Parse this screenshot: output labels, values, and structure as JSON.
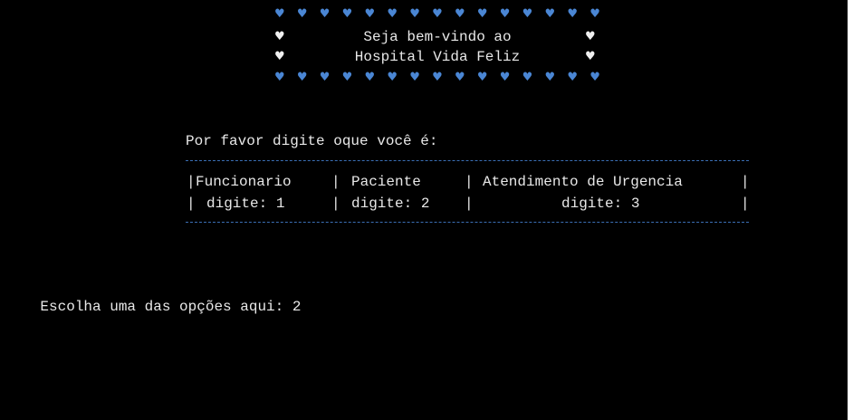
{
  "header": {
    "heart_glyph": "♥",
    "heart_color": "#4a86d4",
    "line1": "Seja bem-vindo ao",
    "line2": "Hospital Vida Feliz"
  },
  "menu": {
    "prompt": "Por favor digite oque você é:",
    "options": [
      {
        "label": "Funcionario",
        "key": "digite: 1"
      },
      {
        "label": "Paciente",
        "key": "digite: 2"
      },
      {
        "label": "Atendimento de Urgencia",
        "key": "digite: 3"
      }
    ],
    "separator_color": "#3b6fb5"
  },
  "input": {
    "prompt": "Escolha uma das opções aqui:",
    "value": "2"
  }
}
